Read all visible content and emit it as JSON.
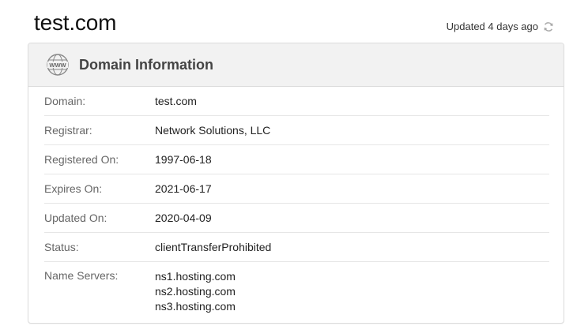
{
  "header": {
    "domain_title": "test.com",
    "updated_text": "Updated 4 days ago",
    "refresh_icon": "refresh-icon"
  },
  "card": {
    "title": "Domain Information",
    "icon": "www-globe-icon",
    "rows": [
      {
        "label": "Domain:",
        "value": "test.com"
      },
      {
        "label": "Registrar:",
        "value": "Network Solutions, LLC"
      },
      {
        "label": "Registered On:",
        "value": "1997-06-18"
      },
      {
        "label": "Expires On:",
        "value": "2021-06-17"
      },
      {
        "label": "Updated On:",
        "value": "2020-04-09"
      },
      {
        "label": "Status:",
        "value": "clientTransferProhibited"
      }
    ],
    "name_servers": {
      "label": "Name Servers:",
      "values": [
        "ns1.hosting.com",
        "ns2.hosting.com",
        "ns3.hosting.com"
      ]
    }
  },
  "colors": {
    "header_bg": "#f2f2f2",
    "border": "#dcdcdc",
    "label_text": "#666666",
    "value_text": "#222222"
  }
}
